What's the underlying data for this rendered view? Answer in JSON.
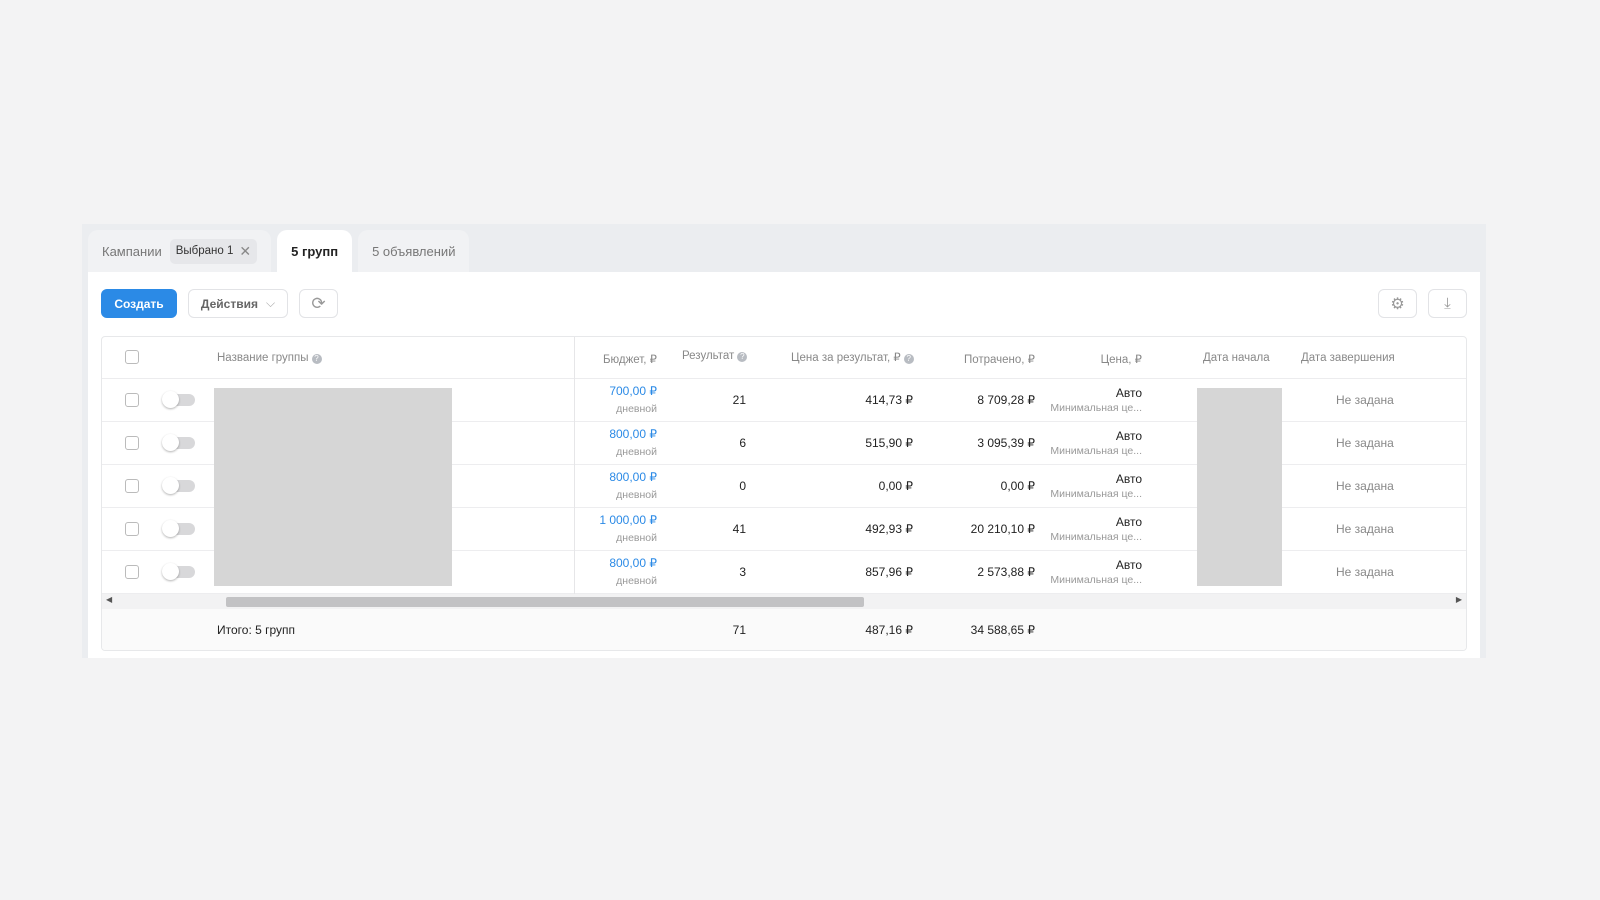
{
  "tabs": {
    "campaigns": "Кампании",
    "selected_chip": "Выбрано 1",
    "groups": "5 групп",
    "ads": "5 объявлений"
  },
  "toolbar": {
    "create": "Создать",
    "actions": "Действия"
  },
  "columns": {
    "name": "Название группы",
    "budget": "Бюджет, ₽",
    "result": "Результат",
    "cpr": "Цена за результат, ₽",
    "spent": "Потрачено, ₽",
    "price": "Цена, ₽",
    "start": "Дата начала",
    "end": "Дата завершения"
  },
  "rows": [
    {
      "budget": "700,00 ₽",
      "budget_type": "дневной",
      "result": "21",
      "cpr": "414,73 ₽",
      "spent": "8 709,28 ₽",
      "price": "Авто",
      "price_sub": "Минимальная це...",
      "end": "Не задана",
      "enabled": false
    },
    {
      "budget": "800,00 ₽",
      "budget_type": "дневной",
      "result": "6",
      "cpr": "515,90 ₽",
      "spent": "3 095,39 ₽",
      "price": "Авто",
      "price_sub": "Минимальная це...",
      "end": "Не задана",
      "enabled": false
    },
    {
      "budget": "800,00 ₽",
      "budget_type": "дневной",
      "result": "0",
      "cpr": "0,00 ₽",
      "spent": "0,00 ₽",
      "price": "Авто",
      "price_sub": "Минимальная це...",
      "end": "Не задана",
      "enabled": false
    },
    {
      "budget": "1 000,00 ₽",
      "budget_type": "дневной",
      "result": "41",
      "cpr": "492,93 ₽",
      "spent": "20 210,10 ₽",
      "price": "Авто",
      "price_sub": "Минимальная це...",
      "end": "Не задана",
      "enabled": false
    },
    {
      "budget": "800,00 ₽",
      "budget_type": "дневной",
      "result": "3",
      "cpr": "857,96 ₽",
      "spent": "2 573,88 ₽",
      "price": "Авто",
      "price_sub": "Минимальная це...",
      "end": "Не задана",
      "enabled": false
    }
  ],
  "footer": {
    "label": "Итого: 5 групп",
    "result": "71",
    "cpr": "487,16 ₽",
    "spent": "34 588,65 ₽"
  },
  "colors": {
    "accent": "#2b8ae6"
  }
}
